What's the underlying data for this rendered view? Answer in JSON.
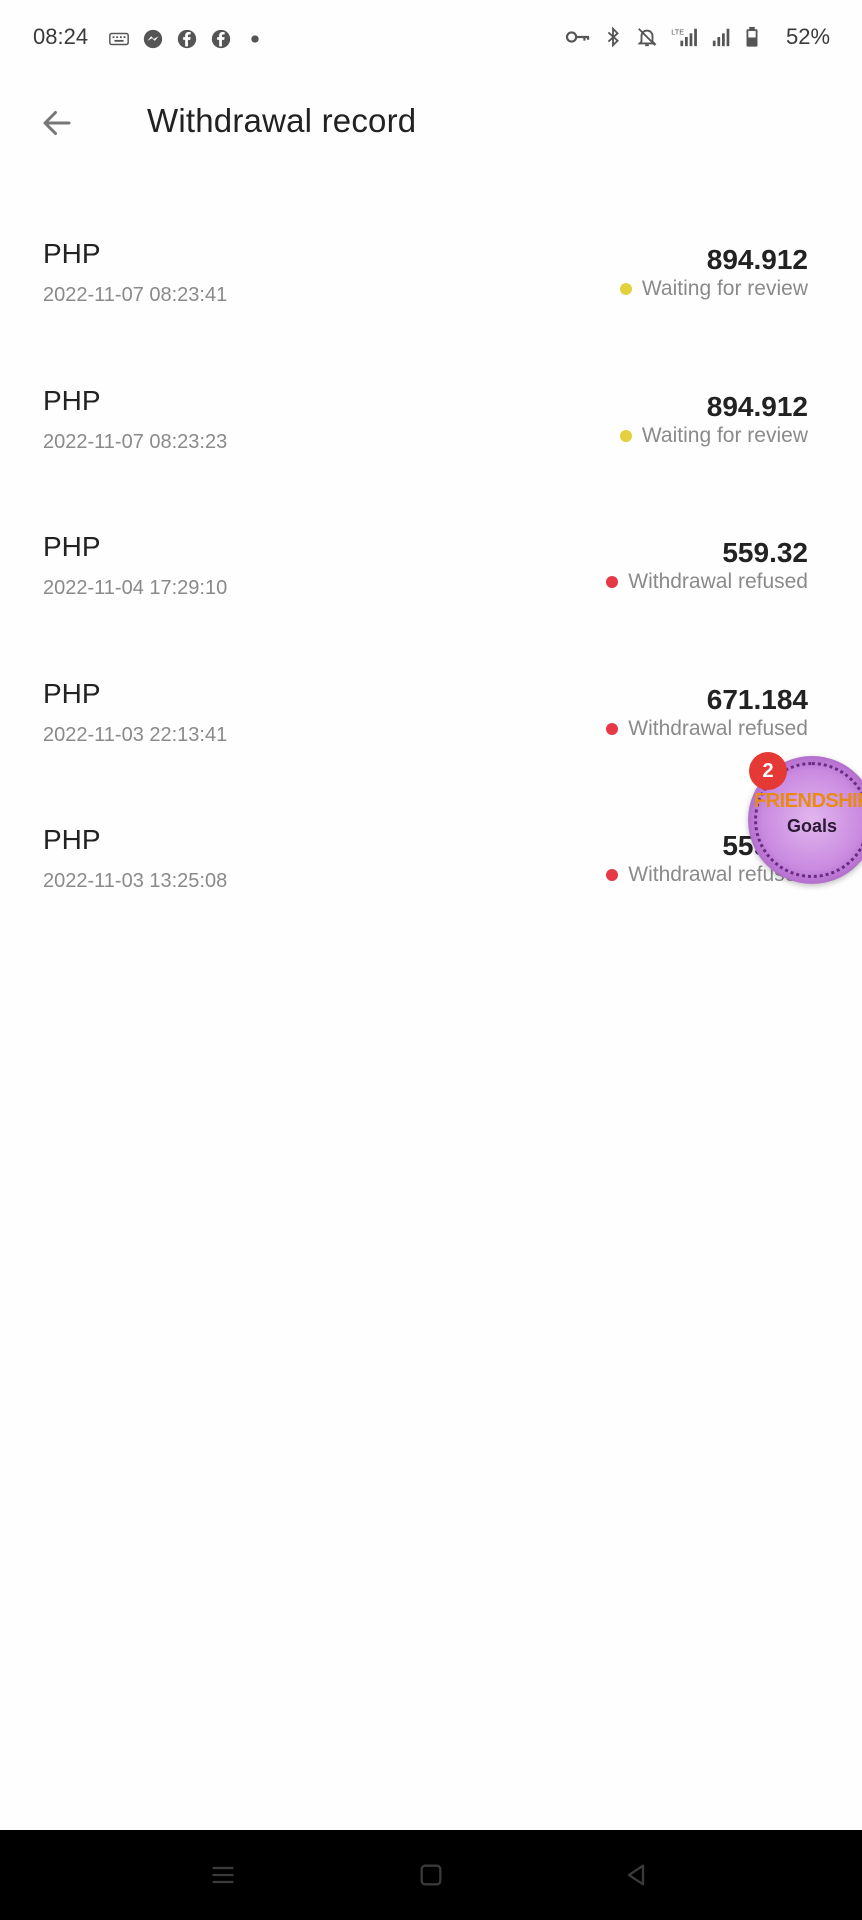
{
  "status_bar": {
    "time": "08:24",
    "battery_text": "52%",
    "left_icons": [
      "keyboard-icon",
      "messenger-icon",
      "facebook-icon",
      "facebook-icon",
      "dot-icon"
    ],
    "right_icons": [
      "vpn-key-icon",
      "bluetooth-icon",
      "notifications-off-icon",
      "lte-signal-icon",
      "signal-icon",
      "battery-icon"
    ]
  },
  "header": {
    "back_icon": "arrow-back-icon",
    "title": "Withdrawal record"
  },
  "records": [
    {
      "currency": "PHP",
      "time": "2022-11-07 08:23:41",
      "amount": "894.912",
      "status": "Waiting for review",
      "status_color": "#e4cf3c"
    },
    {
      "currency": "PHP",
      "time": "2022-11-07 08:23:23",
      "amount": "894.912",
      "status": "Waiting for review",
      "status_color": "#e4cf3c"
    },
    {
      "currency": "PHP",
      "time": "2022-11-04 17:29:10",
      "amount": "559.32",
      "status": "Withdrawal refused",
      "status_color": "#e53945"
    },
    {
      "currency": "PHP",
      "time": "2022-11-03 22:13:41",
      "amount": "671.184",
      "status": "Withdrawal refused",
      "status_color": "#e53945"
    },
    {
      "currency": "PHP",
      "time": "2022-11-03 13:25:08",
      "amount": "559.32",
      "status": "Withdrawal refused",
      "status_color": "#e53945"
    }
  ],
  "floating_bubble": {
    "badge_count": "2",
    "text_top": "FRIENDSHIP",
    "text_bottom": "Goals"
  },
  "nav_bar": {
    "icons": [
      "menu-icon",
      "home-icon",
      "back-triangle-icon"
    ]
  }
}
